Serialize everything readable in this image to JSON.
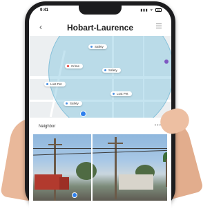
{
  "status_bar": {
    "time": "9:41",
    "signal_icons": "▮▮▮ ᯤ"
  },
  "header": {
    "title": "Hobart-Laurence",
    "back_icon": "chevron-left-icon",
    "menu_icon": "menu-icon"
  },
  "map": {
    "pins": [
      {
        "label": "Safety",
        "kind": "info"
      },
      {
        "label": "Crime",
        "kind": "alert"
      },
      {
        "label": "Safety",
        "kind": "info"
      },
      {
        "label": "Lost Pet",
        "kind": "info"
      },
      {
        "label": "Lost Pet",
        "kind": "info"
      },
      {
        "label": "Safety",
        "kind": "info"
      }
    ]
  },
  "neighbor": {
    "label": "Neighbor",
    "more": "•••"
  },
  "colors": {
    "accent": "#2f80ed",
    "alert": "#e53935",
    "range": "#7fc4de"
  }
}
